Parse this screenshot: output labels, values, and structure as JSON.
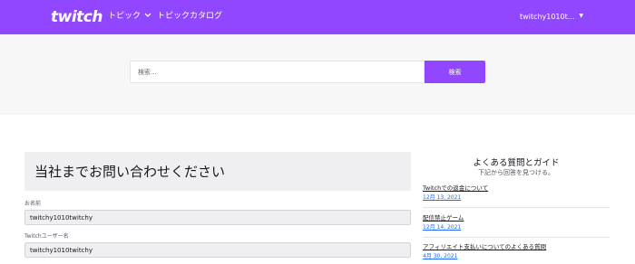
{
  "header": {
    "logo_text": "twitch",
    "nav": [
      {
        "label": "トピック"
      },
      {
        "label": "トピックカタログ"
      }
    ],
    "user": {
      "name": "twitchy1010t..."
    },
    "colors": {
      "brand": "#9147ff"
    }
  },
  "search": {
    "placeholder": "検索...",
    "button_label": "検索"
  },
  "form": {
    "title": "当社までお問い合わせください",
    "fields": [
      {
        "label": "お名前",
        "value": "twitchy1010twitchy"
      },
      {
        "label": "Twitchユーザー名",
        "value": "twitchy1010twitchy"
      }
    ]
  },
  "faq": {
    "title": "よくある質問とガイド",
    "subtitle": "下記から回答を見つける。",
    "items": [
      {
        "title": "Twitchでの返金について",
        "date": "12月 13, 2021"
      },
      {
        "title": "配信禁止ゲーム",
        "date": "12月 14, 2021"
      },
      {
        "title": "アフィリエイト支払いについてのよくある質問",
        "date": "4月 30, 2021"
      }
    ]
  }
}
